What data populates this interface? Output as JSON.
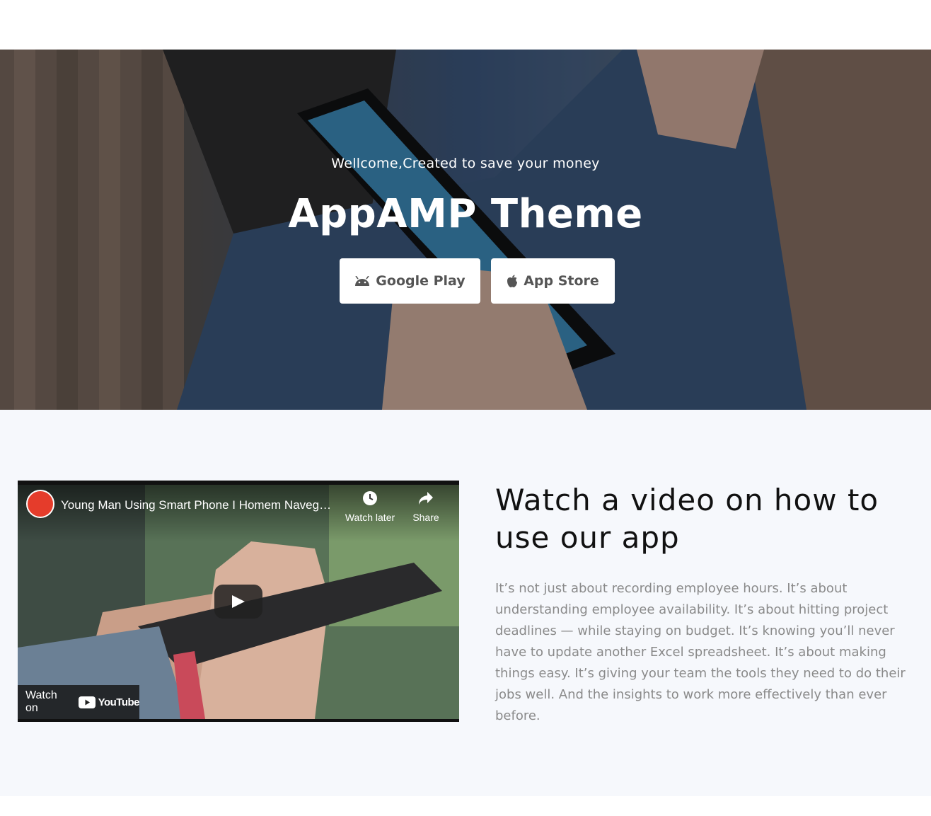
{
  "hero": {
    "subtitle": "Wellcome,Created to save your money",
    "title": "AppAMP Theme",
    "buttons": [
      {
        "label": "Google Play",
        "icon": "android-icon"
      },
      {
        "label": "App Store",
        "icon": "apple-icon"
      }
    ]
  },
  "video": {
    "title": "Young Man Using Smart Phone I Homem Navegando no Celular",
    "watch_later": "Watch later",
    "share": "Share",
    "watch_on": "Watch on",
    "brand": "YouTube"
  },
  "section": {
    "title": "Watch a video on how to use our app",
    "body": "It’s not just about recording employee hours. It’s about understanding employee availability. It’s about hitting project deadlines — while staying on budget. It’s knowing you’ll never have to update another Excel spreadsheet. It’s about making things easy. It’s giving your team the tools they need to do their jobs well. And the insights to work more effectively than ever before."
  },
  "colors": {
    "section_bg": "#f6f8fc",
    "body_text": "#8a8a8a",
    "youtube_red": "#ff0000"
  }
}
